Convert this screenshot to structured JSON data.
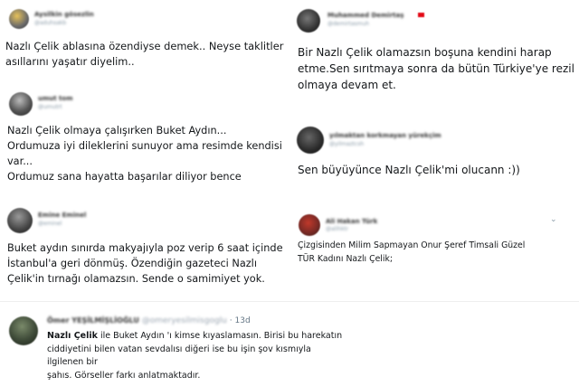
{
  "tweets": [
    {
      "name": "Aysilkin gösezlin",
      "handle": "@aduhsakb",
      "text": "Nazlı Çelik ablasına özendiyse demek.. Neyse taklitler\nasıllarını yaşatır diyelim.."
    },
    {
      "name": "Muhammed Demirtaş",
      "handle": "@demirtasmuh",
      "text": "Bir Nazlı Çelik olamazsın boşuna kendini harap\netme.Sen sırıtmaya sonra da bütün Türkiye'ye rezil\nolmaya devam et."
    },
    {
      "name": "umut tom",
      "handle": "@umutrt",
      "text": "Nazlı Çelik olmaya çalışırken Buket Aydın...\nOrdumuza iyi dileklerini sunuyor ama resimde kendisi\nvar...\nOrdumuz sana hayatta başarılar diliyor bence"
    },
    {
      "name": "yılmaktan korkmayan yürekçim",
      "handle": "@yilmaztcsh",
      "text": "Sen büyüyünce Nazlı Çelik'mi olucann :))"
    },
    {
      "name": "Emine Eminel",
      "handle": "@eminel",
      "text": "Buket aydın sınırda makyajıyla poz verip 6 saat içinde\nİstanbul'a geri dönmüş. Özendiğin gazeteci Nazlı\nÇelik'in tırnağı olamazsın. Sende o samimiyet yok."
    },
    {
      "name": "Ali Hakan Türk",
      "handle": "@alihktr",
      "chevron": "⌄",
      "text": "Çizgisinden Milim Sapmayan Onur Şeref Timsali Güzel\nTÜR Kadını Nazlı Çelik;"
    },
    {
      "name": "Ömer YEŞİLMİŞLİOĞLU",
      "handle": "@omeryesilmisgoglu",
      "time": "· 13d",
      "bold_text": "Nazlı Çelik",
      "text_rest": " ile Buket Aydın 'ı kimse kıyaslamasın. Birisi bu harekatın\nciddiyetini bilen vatan sevdalısı diğeri ise bu işin şov kısmıyla ilgilenen bir\nşahıs. Görseller farkı anlatmaktadır."
    }
  ],
  "colors": {
    "text": "#14171a",
    "secondary": "#657786",
    "flag": "#e30a17"
  }
}
